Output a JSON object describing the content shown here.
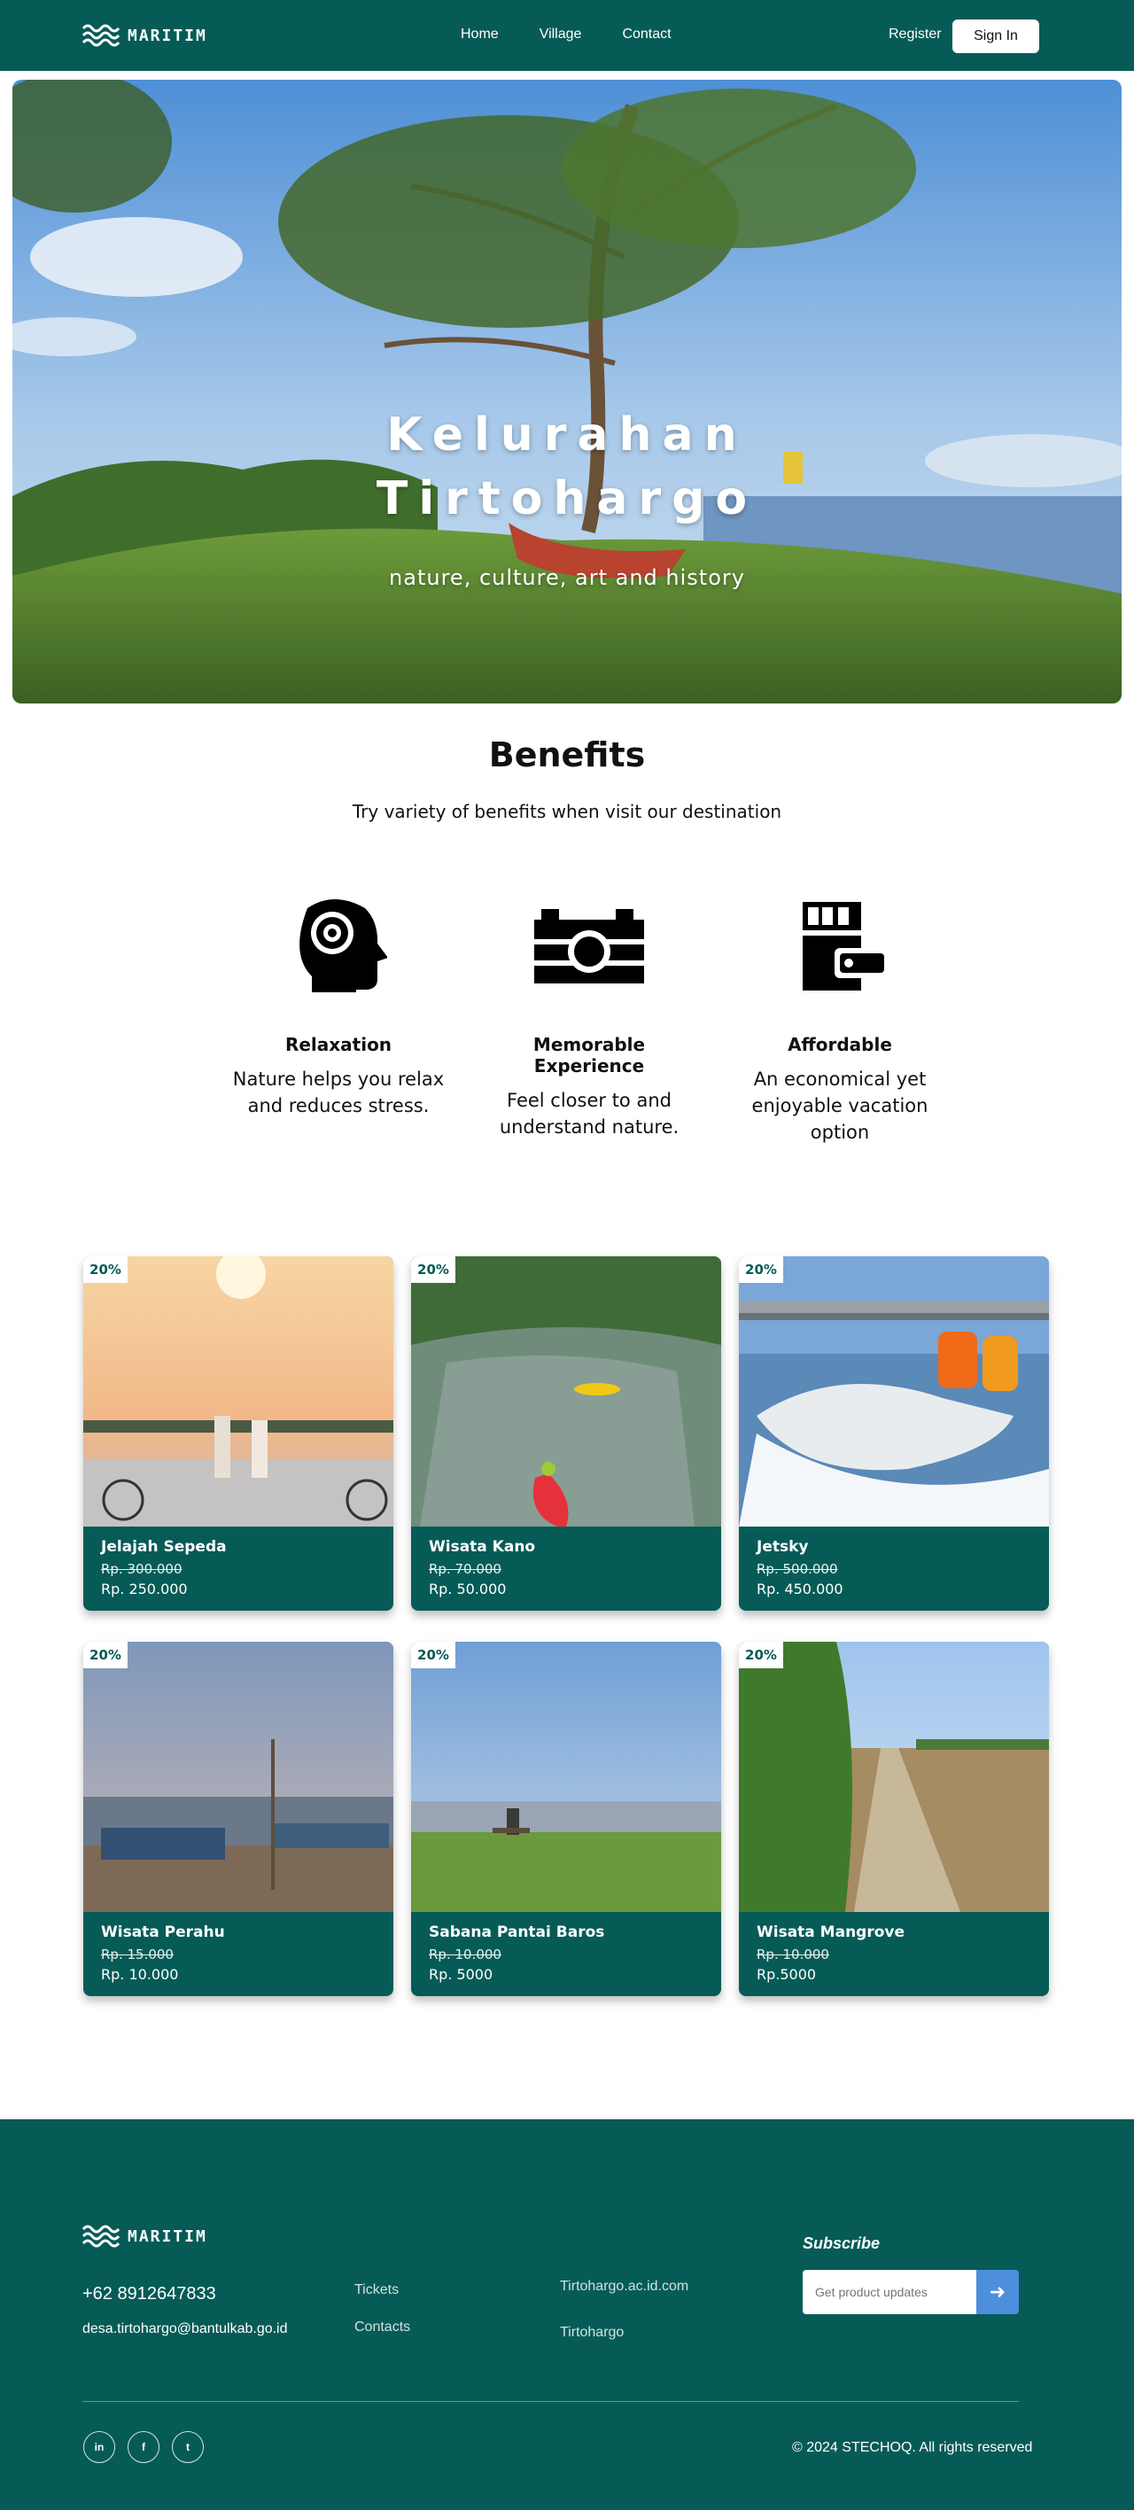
{
  "nav": {
    "brand": "MARITIM",
    "links": [
      "Home",
      "Village",
      "Contact"
    ],
    "register": "Register",
    "signin": "Sign In"
  },
  "hero": {
    "title_line1": "Kelurahan",
    "title_line2": "Tirtohargo",
    "subtitle": "nature, culture, art and history"
  },
  "benefits": {
    "title": "Benefits",
    "subtitle": "Try variety of benefits when visit our destination",
    "items": [
      {
        "icon": "head-target-icon",
        "title": "Relaxation",
        "text": "Nature helps you relax and reduces stress."
      },
      {
        "icon": "camera-icon",
        "title": "Memorable Experience",
        "text": "Feel closer to and understand nature."
      },
      {
        "icon": "wallet-icon",
        "title": "Affordable",
        "text": "An economical yet enjoyable vacation option"
      }
    ]
  },
  "cards": [
    {
      "badge": "20%",
      "name": "Jelajah Sepeda",
      "old_price": "Rp. 300.000",
      "new_price": "Rp. 250.000"
    },
    {
      "badge": "20%",
      "name": "Wisata Kano",
      "old_price": "Rp. 70.000",
      "new_price": "Rp. 50.000"
    },
    {
      "badge": "20%",
      "name": "Jetsky",
      "old_price": "Rp. 500.000",
      "new_price": "Rp. 450.000"
    },
    {
      "badge": "20%",
      "name": "Wisata Perahu",
      "old_price": "Rp. 15.000",
      "new_price": "Rp. 10.000"
    },
    {
      "badge": "20%",
      "name": "Sabana Pantai Baros",
      "old_price": "Rp. 10.000",
      "new_price": "Rp. 5000"
    },
    {
      "badge": "20%",
      "name": "Wisata Mangrove",
      "old_price": "Rp. 10.000",
      "new_price": "Rp.5000"
    }
  ],
  "footer": {
    "brand": "MARITIM",
    "phone": "+62 8912647833",
    "email": "desa.tirtohargo@bantulkab.go.id",
    "links_col1": [
      "Tickets",
      "Contacts"
    ],
    "links_col2": [
      "Tirtohargo.ac.id.com",
      "Tirtohargo"
    ],
    "subscribe_title": "Subscribe",
    "subscribe_placeholder": "Get product updates",
    "social": [
      "in",
      "f",
      "t"
    ],
    "copyright": "© 2024 STECHOQ. All rights reserved"
  },
  "colors": {
    "primary": "#065b57",
    "accent": "#4d8fdc"
  }
}
